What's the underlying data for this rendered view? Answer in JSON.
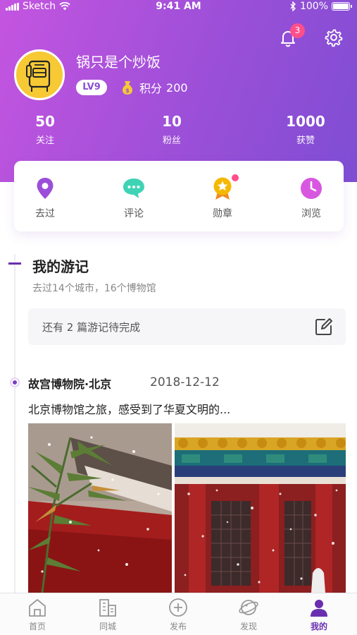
{
  "status_bar": {
    "carrier": "Sketch",
    "time": "9:41 AM",
    "battery": "100%"
  },
  "notifications": {
    "count": "3"
  },
  "profile": {
    "username": "锅只是个炒饭",
    "level": "LV9",
    "points_label": "积分",
    "points_value": "200"
  },
  "stats": [
    {
      "value": "50",
      "label": "关注"
    },
    {
      "value": "10",
      "label": "粉丝"
    },
    {
      "value": "1000",
      "label": "获赞"
    }
  ],
  "quick_nav": [
    {
      "label": "去过",
      "icon": "location-pin-icon",
      "color": "#9b4fd9"
    },
    {
      "label": "评论",
      "icon": "comment-icon",
      "color": "#3fd3b5"
    },
    {
      "label": "勋章",
      "icon": "medal-icon",
      "color": "#f5b800"
    },
    {
      "label": "浏览",
      "icon": "clock-icon",
      "color": "#d857e0"
    }
  ],
  "travelogue": {
    "title": "我的游记",
    "subtitle": "去过14个城市，16个博物馆",
    "pending_text": "还有 2 篇游记待完成"
  },
  "entry": {
    "place": "故宫博物院·北京",
    "date": "2018-12-12",
    "description": "北京博物馆之旅，感受到了华夏文明的..."
  },
  "tab_bar": [
    {
      "label": "首页",
      "icon": "home-icon"
    },
    {
      "label": "同城",
      "icon": "city-icon"
    },
    {
      "label": "发布",
      "icon": "plus-circle-icon"
    },
    {
      "label": "发现",
      "icon": "planet-icon"
    },
    {
      "label": "我的",
      "icon": "user-icon",
      "active": true
    }
  ],
  "colors": {
    "accent": "#6a2fb0",
    "header_start": "#c455e0",
    "header_end": "#7e4ed3",
    "badge": "#ff4f8b"
  }
}
